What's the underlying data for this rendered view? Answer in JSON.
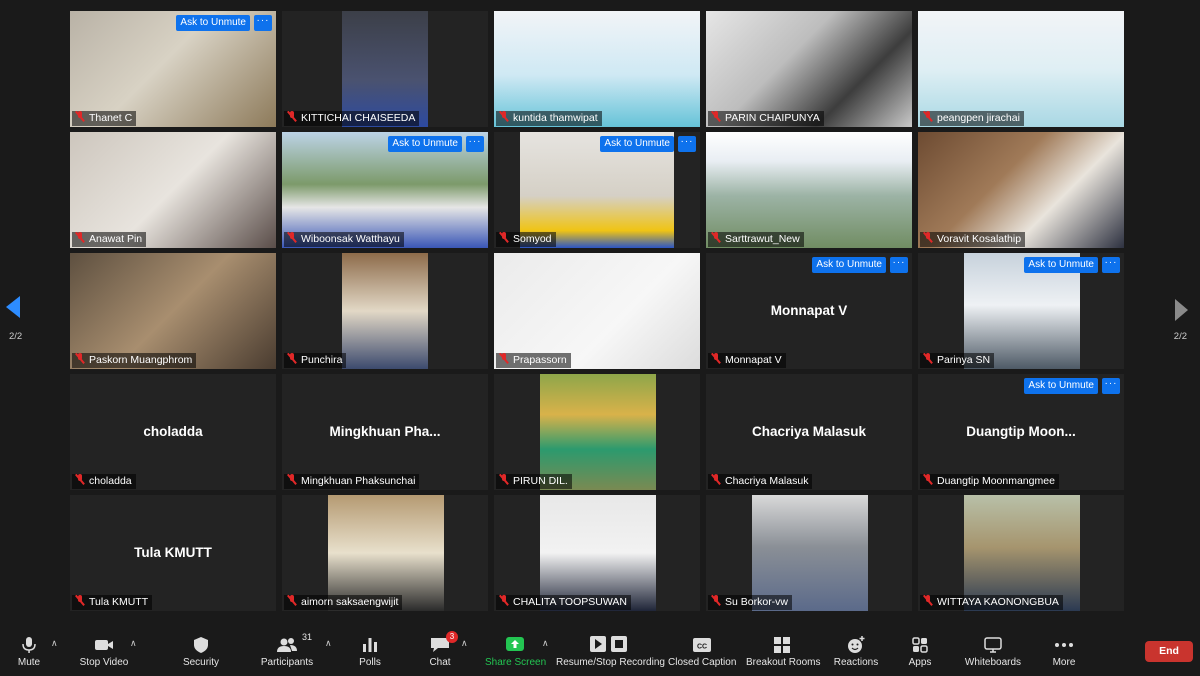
{
  "unmute_label": "Ask to Unmute",
  "more_label": "···",
  "page_left": "2/2",
  "page_right": "2/2",
  "tiles": [
    {
      "name": "Thanet C",
      "unmute": true
    },
    {
      "name": "KITTICHAI CHAISEEDA"
    },
    {
      "name": "kuntida thamwipat"
    },
    {
      "name": "PARIN CHAIPUNYA"
    },
    {
      "name": "peangpen jirachai"
    },
    {
      "name": "Anawat Pin"
    },
    {
      "name": "Wiboonsak Watthayu",
      "unmute": true
    },
    {
      "name": "Somyod",
      "unmute": true
    },
    {
      "name": "Sarttrawut_New"
    },
    {
      "name": "Voravit Kosalathip"
    },
    {
      "name": "Paskorn Muangphrom"
    },
    {
      "name": "Punchira"
    },
    {
      "name": "Prapassorn"
    },
    {
      "name": "Monnapat V",
      "display": "Monnapat V",
      "unmute": true
    },
    {
      "name": "Parinya SN",
      "unmute": true
    },
    {
      "name": "choladda",
      "display": "choladda"
    },
    {
      "name": "Mingkhuan Phaksunchai",
      "display": "Mingkhuan  Pha..."
    },
    {
      "name": "PIRUN DIL."
    },
    {
      "name": "Chacriya Malasuk",
      "display": "Chacriya Malasuk"
    },
    {
      "name": "Duangtip Moonmangmee",
      "display": "Duangtip  Moon...",
      "unmute": true
    },
    {
      "name": "Tula KMUTT",
      "display": "Tula KMUTT"
    },
    {
      "name": "aimorn saksaengwijit"
    },
    {
      "name": "CHALITA TOOPSUWAN"
    },
    {
      "name": "Su Borkor-vw"
    },
    {
      "name": "WITTAYA KAONONGBUA"
    }
  ],
  "toolbar": {
    "mute": "Mute",
    "stop_video": "Stop Video",
    "security": "Security",
    "participants": "Participants",
    "participants_count": "31",
    "polls": "Polls",
    "chat": "Chat",
    "chat_badge": "3",
    "share_screen": "Share Screen",
    "recording": "Resume/Stop Recording",
    "closed_caption": "Closed Caption",
    "breakout_rooms": "Breakout Rooms",
    "reactions": "Reactions",
    "apps": "Apps",
    "whiteboards": "Whiteboards",
    "more": "More",
    "end": "End"
  },
  "colors": {
    "accent": "#0e72ed",
    "end": "#c9342e",
    "share": "#23c552",
    "mic_off": "#e02828"
  }
}
